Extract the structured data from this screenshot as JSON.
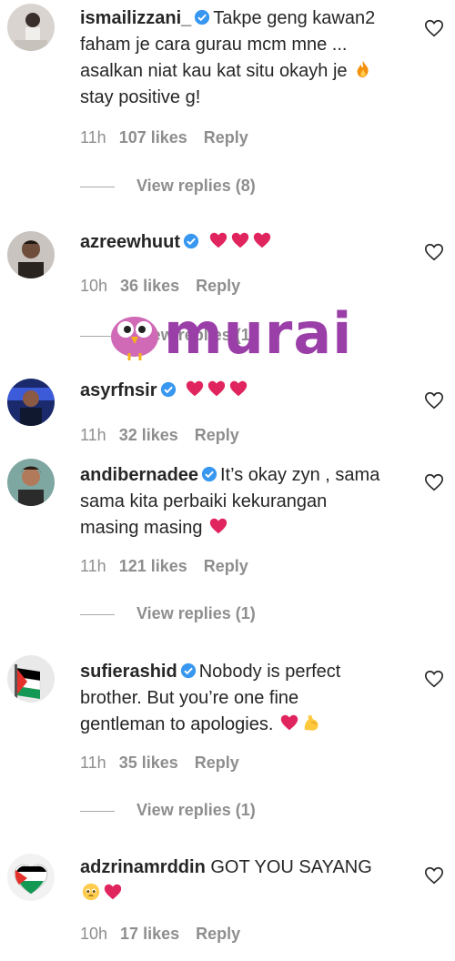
{
  "comments": [
    {
      "username": "ismailizzani_",
      "text_line1": "Takpe geng",
      "text_rest": "kawan2 faham je cara gurau mcm mne ... asalkan niat kau kat situ okayh je",
      "text_after_emoji": "stay positive g!",
      "time": "11h",
      "likes": "107 likes",
      "reply": "Reply",
      "view_replies": "View replies (8)"
    },
    {
      "username": "azreewhuut",
      "time": "10h",
      "likes": "36 likes",
      "reply": "Reply",
      "view_replies": "View replies (1)"
    },
    {
      "username": "asyrfnsir",
      "time": "11h",
      "likes": "32 likes",
      "reply": "Reply"
    },
    {
      "username": "andibernadee",
      "text_line1": "It’s okay zyn ,",
      "text_rest": "sama sama kita perbaiki kekurangan masing masing",
      "time": "11h",
      "likes": "121 likes",
      "reply": "Reply",
      "view_replies": "View replies (1)"
    },
    {
      "username": "sufierashid",
      "text_line1": "Nobody is perfect",
      "text_rest": "brother. But you’re one fine gentleman to apologies.",
      "time": "11h",
      "likes": "35 likes",
      "reply": "Reply",
      "view_replies": "View replies (1)"
    },
    {
      "username": "adzrinamrddin",
      "text_line1": "GOT YOU SAYANG",
      "time": "10h",
      "likes": "17 likes",
      "reply": "Reply"
    }
  ],
  "watermark": {
    "text": "murai"
  },
  "colors": {
    "text": "#262626",
    "secondary": "#8e8e8e",
    "verified": "#3897f0",
    "heart": "#e0245e",
    "watermark": "#9b3fa8"
  }
}
